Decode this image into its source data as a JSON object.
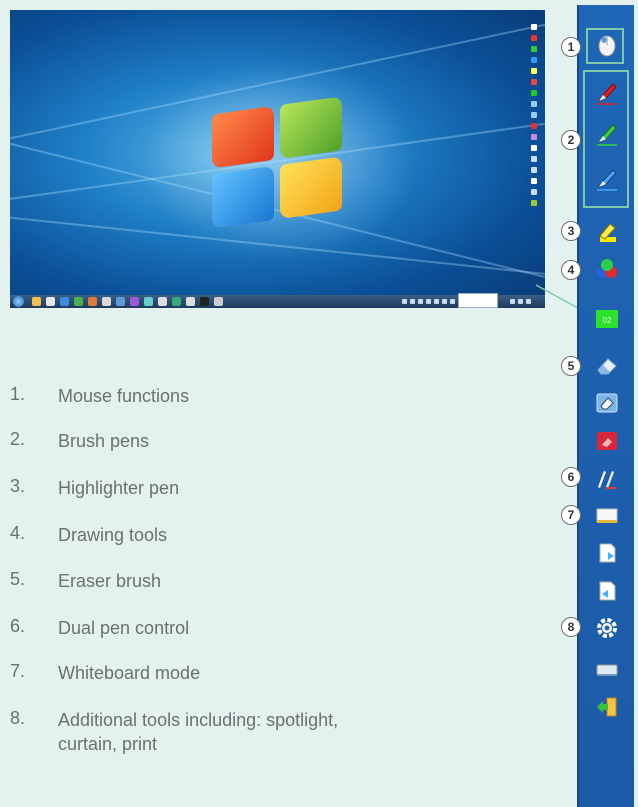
{
  "screenshot": {
    "alt": "Windows desktop screenshot with annotation toolbar",
    "tooltip_text": ""
  },
  "features": [
    {
      "number": "1.",
      "label": "Mouse functions"
    },
    {
      "number": "2.",
      "label": "Brush pens"
    },
    {
      "number": "3.",
      "label": "Highlighter pen"
    },
    {
      "number": "4.",
      "label": "Drawing tools"
    },
    {
      "number": "5.",
      "label": "Eraser brush"
    },
    {
      "number": "6.",
      "label": "Dual pen control"
    },
    {
      "number": "7.",
      "label": "Whiteboard mode"
    },
    {
      "number": "8.",
      "label": "Additional tools including: spotlight, curtain, print"
    }
  ],
  "callouts": [
    "1",
    "2",
    "3",
    "4",
    "5",
    "6",
    "7",
    "8"
  ],
  "toolbar": {
    "background": "#1f66b6",
    "bracket_color": "#7fc9a6",
    "tools": [
      {
        "name": "mouse-icon",
        "label": "Mouse functions"
      },
      {
        "name": "red-pen-icon",
        "label": "Red brush pen"
      },
      {
        "name": "green-pen-icon",
        "label": "Green brush pen"
      },
      {
        "name": "blue-pen-icon",
        "label": "Blue brush pen"
      },
      {
        "name": "highlighter-icon",
        "label": "Highlighter pen"
      },
      {
        "name": "drawing-tools-icon",
        "label": "Drawing tools"
      },
      {
        "name": "whiteboard-green-icon",
        "label": "Green screen"
      },
      {
        "name": "eraser-icon",
        "label": "Eraser brush"
      },
      {
        "name": "area-eraser-icon",
        "label": "Area eraser"
      },
      {
        "name": "clear-page-icon",
        "label": "Clear"
      },
      {
        "name": "dual-pen-icon",
        "label": "Dual pen control"
      },
      {
        "name": "whiteboard-icon",
        "label": "Whiteboard mode"
      },
      {
        "name": "page-forward-icon",
        "label": "Page"
      },
      {
        "name": "page-back-icon",
        "label": "Page"
      },
      {
        "name": "gear-icon",
        "label": "Additional tools"
      },
      {
        "name": "keyboard-icon",
        "label": "Keyboard"
      },
      {
        "name": "exit-icon",
        "label": "Exit"
      }
    ]
  }
}
